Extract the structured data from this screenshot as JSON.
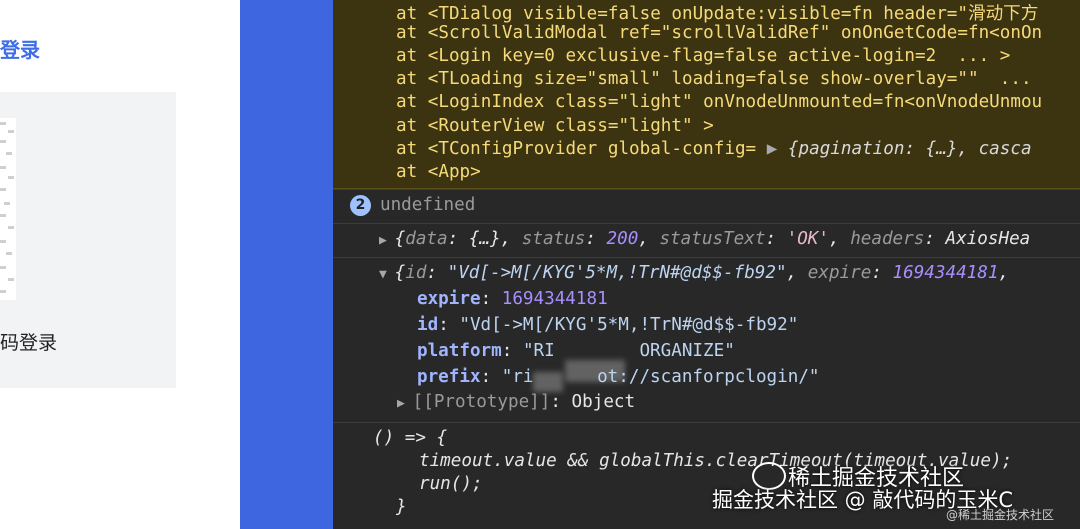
{
  "left_panel": {
    "login_title": "登录",
    "scan_text": "码登录"
  },
  "console": {
    "warning_lines": [
      "at <TDialog visible=false onUpdate:visible=fn header=\"滑动下方",
      "at <ScrollValidModal ref=\"scrollValidRef\" onOnGetCode=fn<onOn",
      "at <Login key=0 exclusive-flag=false active-login=2  ... >",
      "at <TLoading size=\"small\" loading=false show-overlay=\"\"  ...",
      "at <LoginIndex class=\"light\" onVnodeUnmounted=fn<onVnodeUnmou",
      "at <RouterView class=\"light\" >",
      "at <TConfigProvider global-config= ",
      "at <App>"
    ],
    "config_preview": "{pagination: {…}, casca",
    "badge_count": "2",
    "undefined_text": "undefined",
    "response_summary": {
      "data_key": "data",
      "data_val": "{…}",
      "status_key": "status",
      "status_val": "200",
      "statusText_key": "statusText",
      "statusText_val": "'OK'",
      "headers_key": "headers",
      "headers_val": "AxiosHea"
    },
    "object_header": {
      "id_key": "id",
      "id_val": "\"Vd[->M[/KYG'5*M,!TrN#@d$$-fb92\"",
      "expire_key": "expire",
      "expire_val": "1694344181"
    },
    "object_props": [
      {
        "key": "expire",
        "value": "1694344181",
        "type": "num"
      },
      {
        "key": "id",
        "value": "\"Vd[->M[/KYG'5*M,!TrN#@d$$-fb92\"",
        "type": "str"
      },
      {
        "key": "platform",
        "value": "\"RI        ORGANIZE\"",
        "type": "str"
      },
      {
        "key": "prefix",
        "value": "\"ri      ot://scanforpclogin/\"",
        "type": "str"
      }
    ],
    "prototype_label": "[[Prototype]]",
    "prototype_value": "Object",
    "fn_lines": [
      "() => {",
      "timeout.value && globalThis.clearTimeout(timeout.value);",
      "run();",
      "}"
    ]
  },
  "watermark": {
    "line1": "稀土掘金技术社区",
    "line2": "掘金技术社区 @ 敲代码的玉米C",
    "line3": "@稀土掘金技术社区"
  }
}
